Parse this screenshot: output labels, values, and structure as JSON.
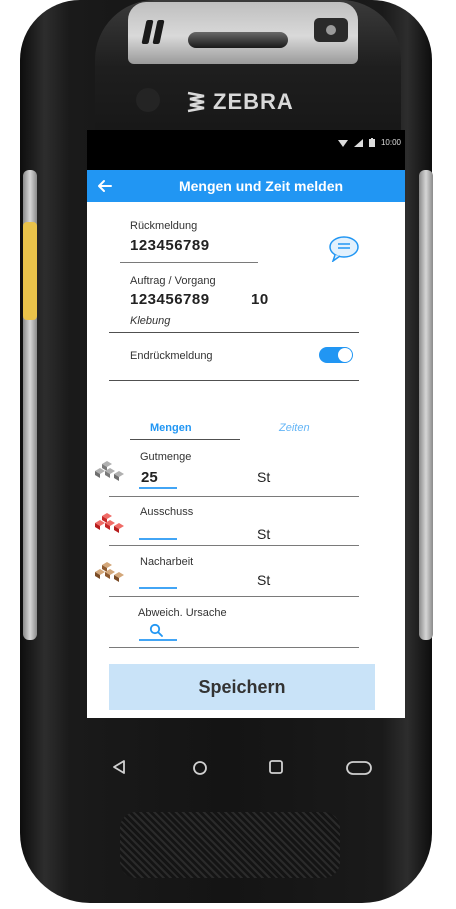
{
  "device": {
    "brand": "ZEBRA"
  },
  "status_bar": {
    "time": "10:00"
  },
  "app_bar": {
    "title": "Mengen und Zeit melden"
  },
  "rueckmeldung": {
    "label": "Rückmeldung",
    "value": "123456789"
  },
  "auftrag": {
    "label": "Auftrag / Vorgang",
    "order": "123456789",
    "operation": "10",
    "description": "Klebung"
  },
  "endrueckmeldung": {
    "label": "Endrückmeldung",
    "enabled": true
  },
  "tabs": [
    {
      "label": "Mengen",
      "active": true
    },
    {
      "label": "Zeiten",
      "active": false
    }
  ],
  "quantities": {
    "gutmenge": {
      "label": "Gutmenge",
      "value": "25",
      "unit": "St",
      "icon": "gray-bars-icon"
    },
    "ausschuss": {
      "label": "Ausschuss",
      "value": "",
      "unit": "St",
      "icon": "red-bars-icon"
    },
    "nacharbeit": {
      "label": "Nacharbeit",
      "value": "",
      "unit": "St",
      "icon": "brown-bars-icon"
    }
  },
  "abweichung": {
    "label": "Abweich. Ursache"
  },
  "save_button": {
    "label": "Speichern"
  },
  "colors": {
    "accent": "#2196f3",
    "button_bg": "#c9e3f8",
    "gray_bars": "#8c8c8c",
    "red_bars": "#e53935",
    "brown_bars": "#b07c4a"
  }
}
